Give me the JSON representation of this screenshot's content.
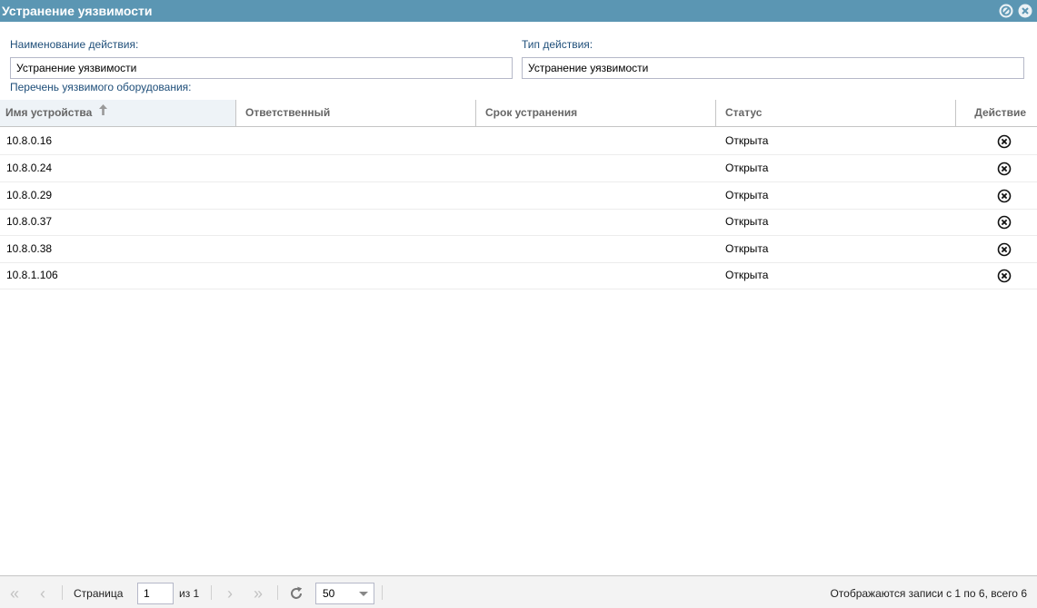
{
  "window": {
    "title": "Устранение уязвимости",
    "minimize_icon": "minimize-icon",
    "close_icon": "close-icon"
  },
  "form": {
    "action_name_label": "Наименование действия:",
    "action_name_value": "Устранение уязвимости",
    "action_type_label": "Тип действия:",
    "action_type_value": "Устранение уязвимости",
    "equipment_list_label": "Перечень уязвимого оборудования:"
  },
  "grid": {
    "columns": [
      "Имя устройства",
      "Ответственный",
      "Срок устранения",
      "Статус",
      "Действие"
    ],
    "sort_icon": "sort-ascending-icon",
    "rows": [
      {
        "device": "10.8.0.16",
        "responsible": "",
        "deadline": "",
        "status": "Открыта",
        "action_icon": "remove-icon"
      },
      {
        "device": "10.8.0.24",
        "responsible": "",
        "deadline": "",
        "status": "Открыта",
        "action_icon": "remove-icon"
      },
      {
        "device": "10.8.0.29",
        "responsible": "",
        "deadline": "",
        "status": "Открыта",
        "action_icon": "remove-icon"
      },
      {
        "device": "10.8.0.37",
        "responsible": "",
        "deadline": "",
        "status": "Открыта",
        "action_icon": "remove-icon"
      },
      {
        "device": "10.8.0.38",
        "responsible": "",
        "deadline": "",
        "status": "Открыта",
        "action_icon": "remove-icon"
      },
      {
        "device": "10.8.1.106",
        "responsible": "",
        "deadline": "",
        "status": "Открыта",
        "action_icon": "remove-icon"
      }
    ]
  },
  "pager": {
    "page_label": "Страница",
    "page_value": "1",
    "of_label": "из 1",
    "page_size": "50",
    "summary": "Отображаются записи с 1 по 6, всего 6",
    "first_glyph": "«",
    "prev_glyph": "‹",
    "next_glyph": "›",
    "last_glyph": "»"
  },
  "colors": {
    "titlebar": "#5b96b3",
    "label": "#1e4e79",
    "header_text": "#666666",
    "sorted_header_bg": "#eef3f7"
  }
}
